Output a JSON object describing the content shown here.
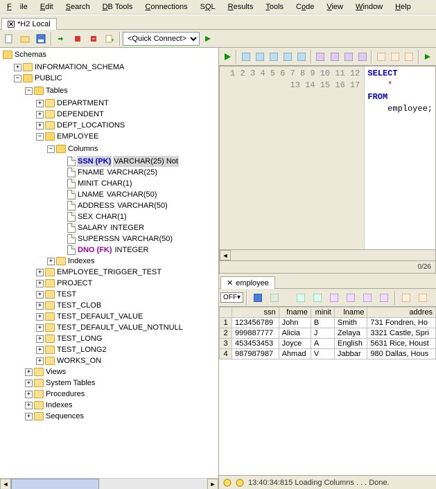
{
  "menu": [
    "File",
    "Edit",
    "Search",
    "DB Tools",
    "Connections",
    "SQL",
    "Results",
    "Tools",
    "Code",
    "View",
    "Window",
    "Help"
  ],
  "window_tab": "*H2 Local",
  "quick_connect": "<Quick Connect>",
  "tree": {
    "root": "Schemas",
    "schemas": [
      {
        "name": "INFORMATION_SCHEMA",
        "expanded": false
      },
      {
        "name": "PUBLIC",
        "expanded": true,
        "children": [
          {
            "name": "Tables",
            "expanded": true,
            "children": [
              {
                "name": "DEPARTMENT"
              },
              {
                "name": "DEPENDENT"
              },
              {
                "name": "DEPT_LOCATIONS"
              },
              {
                "name": "EMPLOYEE",
                "expanded": true,
                "children": [
                  {
                    "name": "Columns",
                    "expanded": true,
                    "columns": [
                      {
                        "name": "SSN (PK)",
                        "type": "VARCHAR(25) Not",
                        "role": "pk",
                        "selected": true
                      },
                      {
                        "name": "FNAME",
                        "type": "VARCHAR(25)"
                      },
                      {
                        "name": "MINIT",
                        "type": "CHAR(1)"
                      },
                      {
                        "name": "LNAME",
                        "type": "VARCHAR(50)"
                      },
                      {
                        "name": "ADDRESS",
                        "type": "VARCHAR(50)"
                      },
                      {
                        "name": "SEX",
                        "type": "CHAR(1)"
                      },
                      {
                        "name": "SALARY",
                        "type": "INTEGER"
                      },
                      {
                        "name": "SUPERSSN",
                        "type": "VARCHAR(50)"
                      },
                      {
                        "name": "DNO (FK)",
                        "type": "INTEGER",
                        "role": "fk"
                      }
                    ]
                  },
                  {
                    "name": "Indexes"
                  }
                ]
              },
              {
                "name": "EMPLOYEE_TRIGGER_TEST"
              },
              {
                "name": "PROJECT"
              },
              {
                "name": "TEST"
              },
              {
                "name": "TEST_CLOB"
              },
              {
                "name": "TEST_DEFAULT_VALUE"
              },
              {
                "name": "TEST_DEFAULT_VALUE_NOTNULL"
              },
              {
                "name": "TEST_LONG"
              },
              {
                "name": "TEST_LONG2"
              },
              {
                "name": "WORKS_ON"
              }
            ]
          },
          {
            "name": "Views"
          },
          {
            "name": "System Tables"
          },
          {
            "name": "Procedures"
          },
          {
            "name": "Indexes"
          },
          {
            "name": "Sequences"
          }
        ]
      }
    ]
  },
  "editor": {
    "lines": 17,
    "code": [
      {
        "t": "SELECT",
        "c": "kw"
      },
      {
        "t": "    *",
        "c": "star"
      },
      {
        "t": "FROM",
        "c": "kw"
      },
      {
        "t": "    employee;",
        "c": ""
      }
    ],
    "status": "0/26"
  },
  "results": {
    "tab": "employee",
    "off_label": "OFF",
    "columns": [
      "ssn",
      "fname",
      "minit",
      "lname",
      "addres"
    ],
    "rows": [
      [
        "123456789",
        "John",
        "B",
        "Smith",
        "731 Fondren, Ho"
      ],
      [
        "999887777",
        "Alicia",
        "J",
        "Zelaya",
        "3321 Castle, Spri"
      ],
      [
        "453453453",
        "Joyce",
        "A",
        "English",
        "5631 Rice, Houst"
      ],
      [
        "987987987",
        "Ahmad",
        "V",
        "Jabbar",
        "980 Dallas, Hous"
      ]
    ]
  },
  "statusbar": "13:40:34:815 Loading Columns . . . Done."
}
